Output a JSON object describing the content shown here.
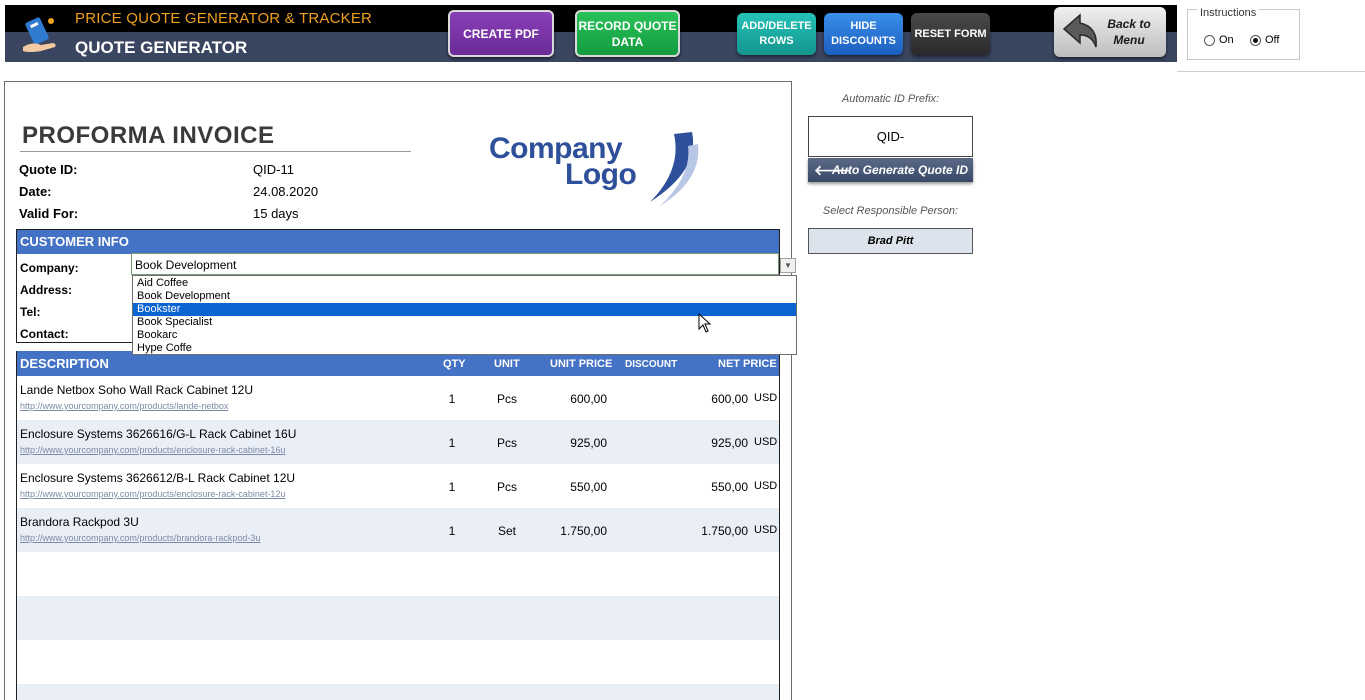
{
  "header": {
    "title": "PRICE QUOTE GENERATOR & TRACKER",
    "subtitle": "QUOTE GENERATOR",
    "buttons": {
      "create_pdf": "CREATE PDF",
      "record_quote_data": "RECORD QUOTE DATA",
      "add_delete_rows": "ADD/DELETE ROWS",
      "hide_discounts": "HIDE DISCOUNTS",
      "reset_form": "RESET FORM",
      "back_to_menu": "Back to Menu"
    },
    "instructions": {
      "label": "Instructions",
      "on_label": "On",
      "off_label": "Off",
      "selected": "Off"
    }
  },
  "invoice": {
    "title": "PROFORMA INVOICE",
    "fields": [
      {
        "label": "Quote ID:",
        "value": "QID-11"
      },
      {
        "label": "Date:",
        "value": "24.08.2020"
      },
      {
        "label": "Valid For:",
        "value": "15 days"
      }
    ],
    "logo": {
      "line1": "Company",
      "line2": "Logo"
    },
    "customer": {
      "header": "CUSTOMER INFO",
      "labels": [
        "Company:",
        "Address:",
        "Tel:",
        "Contact:"
      ],
      "company_value": "Book Development",
      "dropdown_options": [
        "Aid Coffee",
        "Book Development",
        "Bookster",
        "Book Specialist",
        "Bookarc",
        "Hype Coffe"
      ],
      "dropdown_highlighted": "Bookster"
    },
    "table": {
      "headers": {
        "description": "DESCRIPTION",
        "qty": "QTY",
        "unit": "UNIT",
        "unit_price": "UNIT PRICE",
        "discount": "DISCOUNT",
        "net_price": "NET PRICE"
      },
      "rows": [
        {
          "description": "Lande Netbox Soho Wall Rack Cabinet 12U",
          "link": "http://www.yourcompany.com/products/lande-netbox",
          "qty": "1",
          "unit": "Pcs",
          "unit_price": "600,00",
          "net_price": "600,00",
          "currency": "USD"
        },
        {
          "description": "Enclosure Systems 3626616/G-L Rack Cabinet 16U",
          "link": "http://www.yourcompany.com/products/enclosure-rack-cabinet-16u",
          "qty": "1",
          "unit": "Pcs",
          "unit_price": "925,00",
          "net_price": "925,00",
          "currency": "USD"
        },
        {
          "description": "Enclosure Systems 3626612/B-L Rack Cabinet 12U",
          "link": "http://www.yourcompany.com/products/enclosure-rack-cabinet-12u",
          "qty": "1",
          "unit": "Pcs",
          "unit_price": "550,00",
          "net_price": "550,00",
          "currency": "USD"
        },
        {
          "description": "Brandora Rackpod 3U",
          "link": "http://www.yourcompany.com/products/brandora-rackpod-3u",
          "qty": "1",
          "unit": "Set",
          "unit_price": "1.750,00",
          "net_price": "1.750,00",
          "currency": "USD"
        }
      ]
    }
  },
  "side_panel": {
    "prefix_label": "Automatic ID Prefix:",
    "prefix_value": "QID-",
    "auto_generate_button": "Auto Generate Quote ID",
    "responsible_label": "Select Responsible Person:",
    "responsible_value": "Brad Pitt"
  },
  "colors": {
    "accent_blue": "#4472c4",
    "header_band": "#3a4560",
    "title_orange": "#f0a020",
    "create_pdf": "#7a34a8",
    "record_quote": "#1eae4c",
    "add_delete": "#1aa89f",
    "hide_discounts": "#2a74d6",
    "reset_form": "#333333",
    "dropdown_selected": "#0a64d2"
  }
}
